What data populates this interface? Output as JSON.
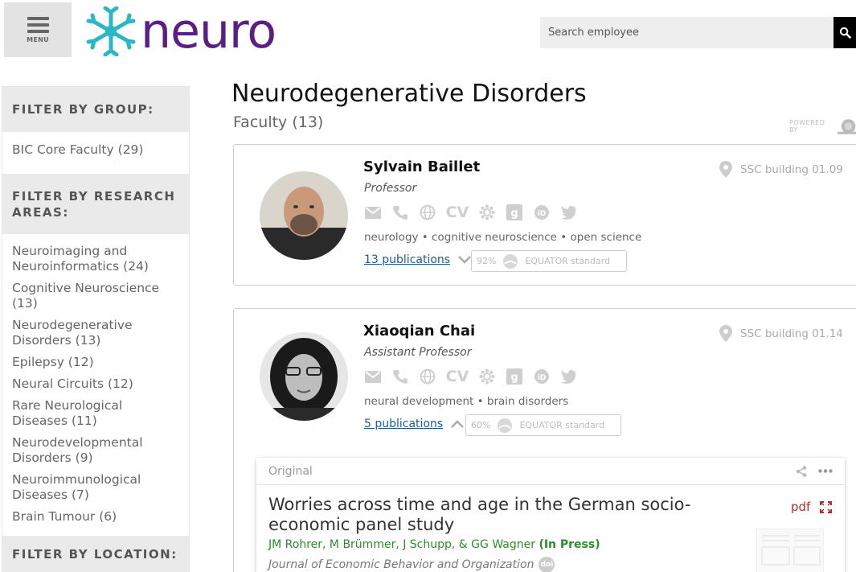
{
  "header": {
    "menu_label": "MENU",
    "logo_text": "neuro",
    "search_placeholder": "Search employee"
  },
  "sidebar": {
    "group_heading": "FILTER BY GROUP:",
    "group_items": [
      {
        "label": "BIC Core Faculty (29)"
      }
    ],
    "research_heading": "FILTER BY RESEARCH AREAS:",
    "research_items": [
      {
        "label": "Neuroimaging and Neuroinformatics (24)"
      },
      {
        "label": "Cognitive Neuroscience (13)"
      },
      {
        "label": "Neurodegenerative Disorders (13)"
      },
      {
        "label": "Epilepsy (12)"
      },
      {
        "label": "Neural Circuits (12)"
      },
      {
        "label": "Rare Neurological Diseases (11)"
      },
      {
        "label": "Neurodevelopmental Disorders (9)"
      },
      {
        "label": "Neuroimmunological Diseases (7)"
      },
      {
        "label": "Brain Tumour (6)"
      }
    ],
    "location_heading": "FILTER BY LOCATION:"
  },
  "main": {
    "title": "Neurodegenerative Disorders",
    "subtitle": "Faculty (13)",
    "powered_by": "POWERED BY",
    "people": [
      {
        "name": "Sylvain Baillet",
        "role": "Professor",
        "location": "SSC building 01.09",
        "tags": "neurology • cognitive neuroscience • open science",
        "publications": "13 publications",
        "equator_pct": "92%",
        "equator_label": "EQUATOR standard"
      },
      {
        "name": "Xiaoqian Chai",
        "role": "Assistant Professor",
        "location": "SSC building 01.14",
        "tags": "neural development • brain disorders",
        "publications": "5 publications",
        "equator_pct": "60%",
        "equator_label": "EQUATOR standard"
      }
    ],
    "contact_icons": [
      "mail-icon",
      "phone-icon",
      "globe-icon",
      "cv-icon",
      "orcid-flower-icon",
      "google-scholar-icon",
      "orcid-icon",
      "twitter-icon"
    ],
    "cv_label": "CV",
    "publication": {
      "status": "Original",
      "title": "Worries across time and age in the German socio-economic panel study",
      "authors": "JM Rohrer, M Brümmer, J Schupp, & GG Wagner",
      "in_press": "(In Press)",
      "journal": "Journal of Economic Behavior and Organization",
      "doi_label": "doi",
      "pdf_label": "pdf"
    }
  },
  "colors": {
    "logo_purple": "#5b1d86",
    "logo_teal": "#2bb7c4",
    "link_blue": "#1f5a97",
    "author_green": "#2e8b2e",
    "pdf_red": "#b03030"
  }
}
